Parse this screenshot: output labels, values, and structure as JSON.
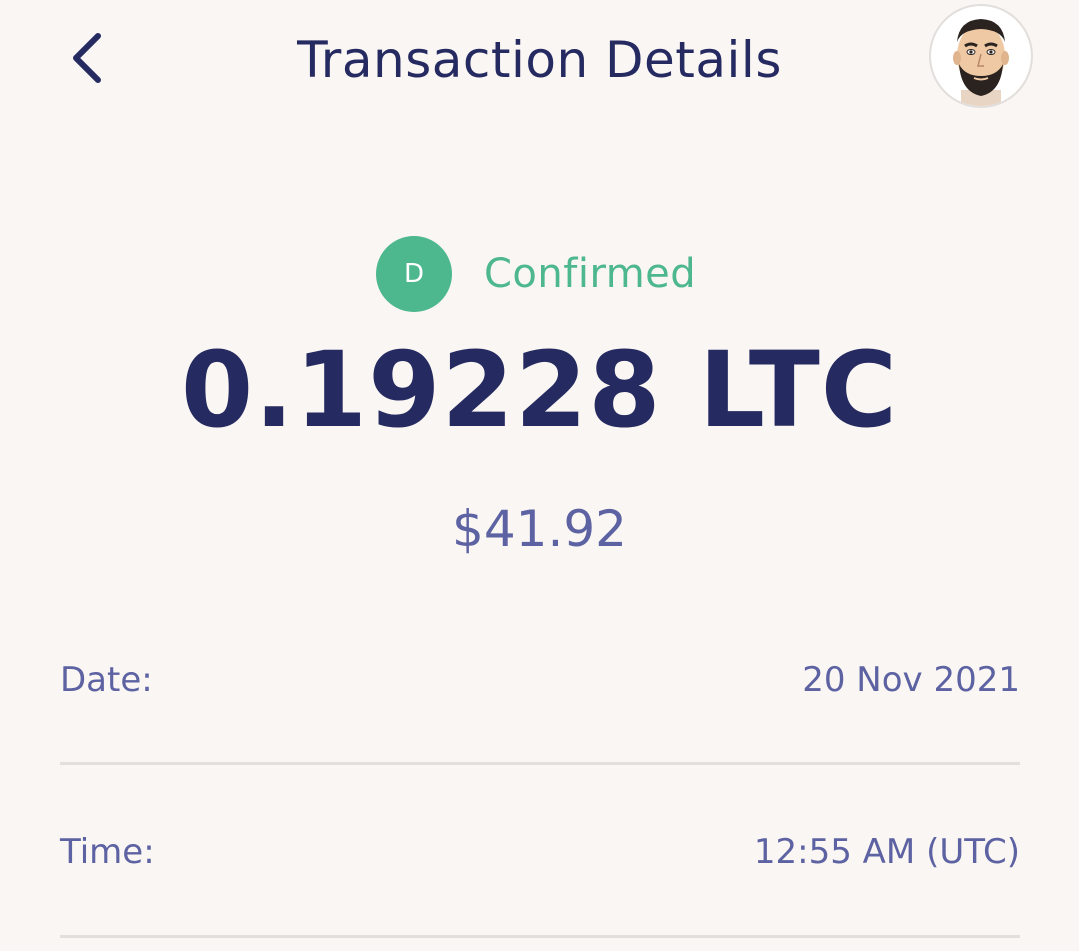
{
  "header": {
    "title": "Transaction Details",
    "back_icon": "chevron-left-icon",
    "avatar_icon": "user-avatar"
  },
  "status": {
    "badge_letter": "D",
    "label": "Confirmed",
    "color": "#4db78e"
  },
  "amount": {
    "crypto": "0.19228 LTC",
    "fiat": "$41.92"
  },
  "details": [
    {
      "label": "Date:",
      "value": "20 Nov 2021"
    },
    {
      "label": "Time:",
      "value": "12:55 AM (UTC)"
    }
  ],
  "colors": {
    "background": "#faf6f3",
    "primary_text": "#252a61",
    "secondary_text": "#5d62a2",
    "accent": "#4db78e",
    "divider": "#e2dfdd"
  }
}
